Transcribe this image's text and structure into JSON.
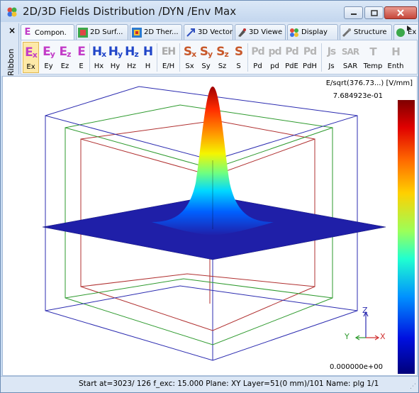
{
  "window": {
    "title": "2D/3D Fields Distribution /DYN /Env Max",
    "minimize_icon": "minimize-icon",
    "maximize_icon": "maximize-icon",
    "close_icon": "close-icon"
  },
  "ribbon": {
    "side_label": "Ribbon",
    "close_glyph": "×",
    "tabs": [
      {
        "label": "Compon."
      },
      {
        "label": "2D Surf..."
      },
      {
        "label": "2D Ther..."
      },
      {
        "label": "3D Vector"
      },
      {
        "label": "3D Viewe"
      },
      {
        "label": "Display"
      },
      {
        "label": "Structure"
      },
      {
        "label": "Ex"
      }
    ],
    "tools": [
      {
        "icon": "Ex",
        "label": "Ex"
      },
      {
        "icon": "Ey",
        "label": "Ey"
      },
      {
        "icon": "Ez",
        "label": "Ez"
      },
      {
        "icon": "E",
        "label": "E"
      },
      {
        "icon": "Hx",
        "label": "Hx"
      },
      {
        "icon": "Hy",
        "label": "Hy"
      },
      {
        "icon": "Hz",
        "label": "Hz"
      },
      {
        "icon": "H",
        "label": "H"
      },
      {
        "icon": "EH",
        "label": "E/H"
      },
      {
        "icon": "Sx",
        "label": "Sx"
      },
      {
        "icon": "Sy",
        "label": "Sy"
      },
      {
        "icon": "Sz",
        "label": "Sz"
      },
      {
        "icon": "S",
        "label": "S"
      },
      {
        "icon": "Pd",
        "label": "Pd"
      },
      {
        "icon": "pd",
        "label": "pd"
      },
      {
        "icon": "PdE",
        "label": "PdE"
      },
      {
        "icon": "PdH",
        "label": "PdH"
      },
      {
        "icon": "Js",
        "label": "Js"
      },
      {
        "icon": "SAR",
        "label": "SAR"
      },
      {
        "icon": "T",
        "label": "Temp"
      },
      {
        "icon": "H",
        "label": "Enth"
      }
    ]
  },
  "plot": {
    "colorbar_title": "E/sqrt(376.73...) [V/mm]",
    "colorbar_max": "7.684923e-01",
    "colorbar_min": "0.000000e+00",
    "axis_z": "Z",
    "axis_y": "Y",
    "axis_x": "X",
    "colors": {
      "outer_box": "#2b2bb0",
      "middle_box": "#2e9a2e",
      "inner_box": "#b03030",
      "plane": "#1f1fa8",
      "peak": "#b00000"
    }
  },
  "status": {
    "text": "Start at=3023/ 126  f_exc: 15.000  Plane: XY  Layer=51(0 mm)/101  Name: plg 1/1"
  }
}
